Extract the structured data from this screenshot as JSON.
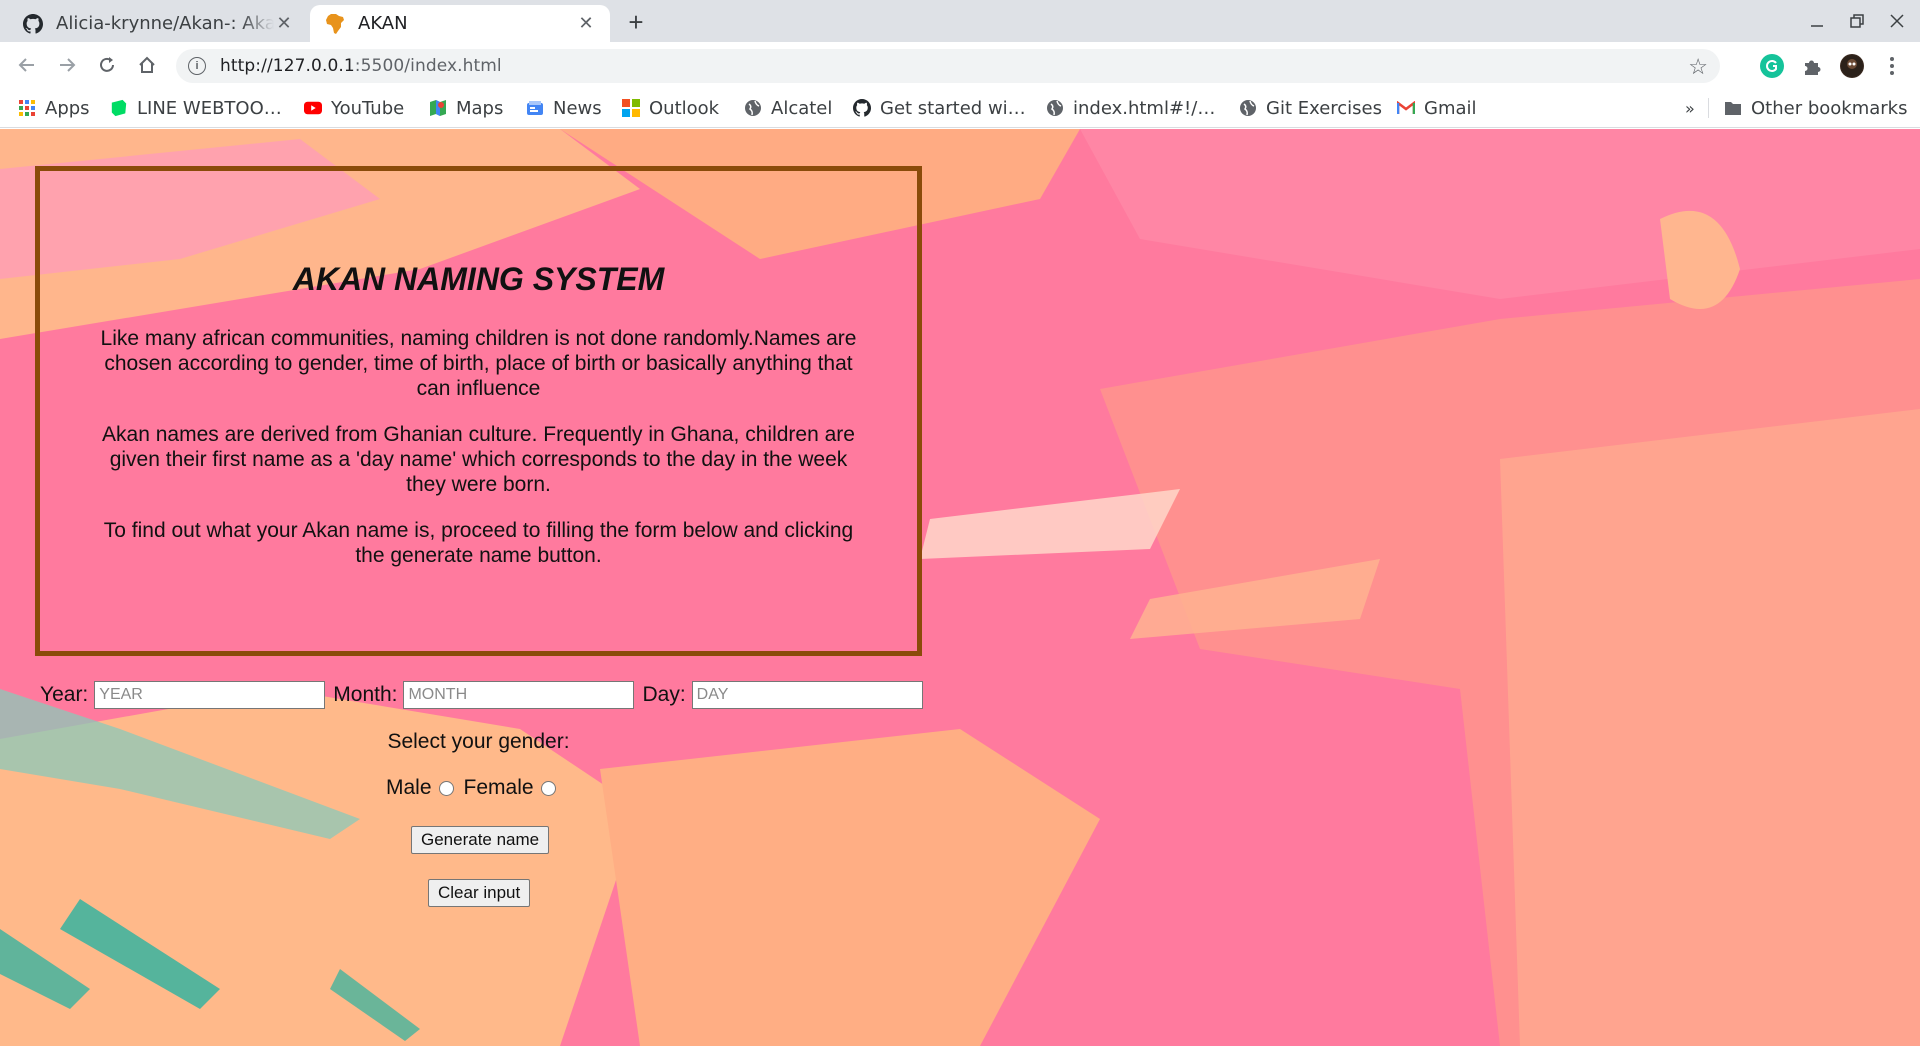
{
  "browser": {
    "tabs": [
      {
        "title": "Alicia-krynne/Akan-: Akan",
        "icon": "github-icon"
      },
      {
        "title": "AKAN",
        "icon": "africa-favicon"
      }
    ],
    "url_host": "http://127.0.0.1",
    "url_path": ":5500/index.html",
    "bookmarks": [
      {
        "label": "Apps",
        "icon": "apps-grid-icon"
      },
      {
        "label": "LINE WEBTOO…",
        "icon": "webtoon-icon"
      },
      {
        "label": "YouTube",
        "icon": "youtube-icon"
      },
      {
        "label": "Maps",
        "icon": "maps-icon"
      },
      {
        "label": "News",
        "icon": "news-icon"
      },
      {
        "label": "Outlook",
        "icon": "outlook-icon"
      },
      {
        "label": "Alcatel",
        "icon": "globe-icon"
      },
      {
        "label": "Get started wi…",
        "icon": "github-icon"
      },
      {
        "label": "index.html#!/…",
        "icon": "globe-icon"
      },
      {
        "label": "Git Exercises",
        "icon": "globe-icon"
      },
      {
        "label": "Gmail",
        "icon": "gmail-icon"
      }
    ],
    "overflow": "»",
    "other_bookmarks": "Other bookmarks"
  },
  "page": {
    "title": "AKAN NAMING SYSTEM",
    "paragraphs": [
      "Like many african communities, naming children is not done randomly.Names are chosen according to gender, time of birth, place of birth or basically anything that can influence",
      "Akan names are derived from Ghanian culture. Frequently in Ghana, children are given their first name as a 'day name' which corresponds to the day in the week they were born.",
      "To find out what your Akan name is, proceed to filling the form below and clicking the generate name button."
    ],
    "form": {
      "year_label": "Year:",
      "year_placeholder": "YEAR",
      "month_label": "Month:",
      "month_placeholder": "MONTH",
      "day_label": "Day:",
      "day_placeholder": "DAY",
      "gender_prompt": "Select your gender:",
      "male_label": "Male",
      "female_label": "Female",
      "generate_button": "Generate name",
      "clear_button": "Clear input"
    }
  },
  "colors": {
    "border": "#8a4b0a",
    "pink": "#ff7da0",
    "peach": "#ffb487"
  }
}
